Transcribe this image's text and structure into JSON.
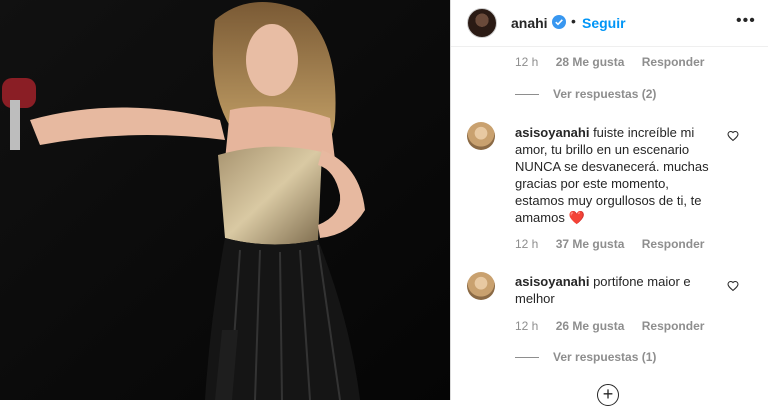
{
  "header": {
    "username": "anahi",
    "dot": "•",
    "follow_label": "Seguir",
    "more_icon": "more-options-icon"
  },
  "comments": [
    {
      "meta": {
        "time": "12 h",
        "likes": "28 Me gusta",
        "reply": "Responder"
      },
      "view_replies": "Ver respuestas (2)"
    },
    {
      "username": "asisoyanahi",
      "lines": [
        "fuiste increíble mi",
        "amor, tu brillo en un escenario",
        "NUNCA se desvanecerá. muchas",
        "gracias por este momento,",
        "estamos muy orgullosos de ti, te",
        "amamos"
      ],
      "emoji": "❤️",
      "meta": {
        "time": "12 h",
        "likes": "37 Me gusta",
        "reply": "Responder"
      }
    },
    {
      "username": "asisoyanahi",
      "lines": [
        "portifone maior e",
        "melhor"
      ],
      "meta": {
        "time": "12 h",
        "likes": "26 Me gusta",
        "reply": "Responder"
      },
      "view_replies": "Ver respuestas (1)"
    }
  ],
  "add_icon": "plus-circle-icon",
  "colors": {
    "accent": "#0095f6",
    "verified": "#3897f0",
    "heart": "#ed4956",
    "muted": "#8e8e8e"
  }
}
